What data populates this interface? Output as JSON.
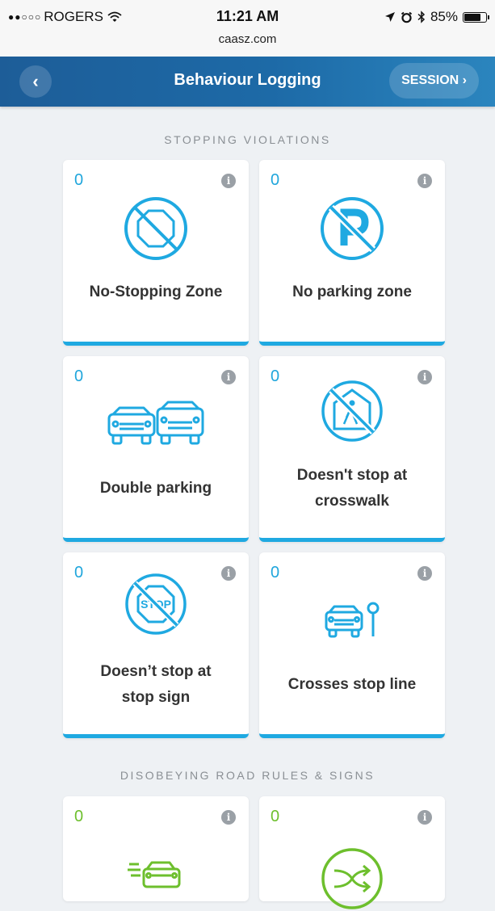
{
  "status_bar": {
    "signal": "●●○○○",
    "carrier": "ROGERS",
    "time": "11:21 AM",
    "url": "caasz.com",
    "battery": "85%",
    "battery_level": 0.85
  },
  "nav": {
    "back_label": "‹",
    "title": "Behaviour Logging",
    "session_label": "SESSION ›"
  },
  "sections": {
    "stopping": {
      "heading": "STOPPING VIOLATIONS",
      "cards": [
        {
          "count": "0",
          "label_line1": "No-Stopping Zone",
          "label_line2": ""
        },
        {
          "count": "0",
          "label_line1": "No parking zone",
          "label_line2": ""
        },
        {
          "count": "0",
          "label_line1": "Double parking",
          "label_line2": ""
        },
        {
          "count": "0",
          "label_line1": "Doesn't stop at",
          "label_line2": "crosswalk"
        },
        {
          "count": "0",
          "label_line1": "Doesn’t stop at",
          "label_line2": "stop sign"
        },
        {
          "count": "0",
          "label_line1": "Crosses stop line",
          "label_line2": ""
        }
      ]
    },
    "road_rules": {
      "heading": "DISOBEYING ROAD RULES & SIGNS",
      "cards": [
        {
          "count": "0"
        },
        {
          "count": "0"
        }
      ]
    }
  },
  "icons": {
    "stop_text": "STOP",
    "info_glyph": "i"
  },
  "colors": {
    "accent_blue": "#1fa9e1",
    "accent_green": "#6dbf2d",
    "nav_blue": "#1d6aa7"
  }
}
